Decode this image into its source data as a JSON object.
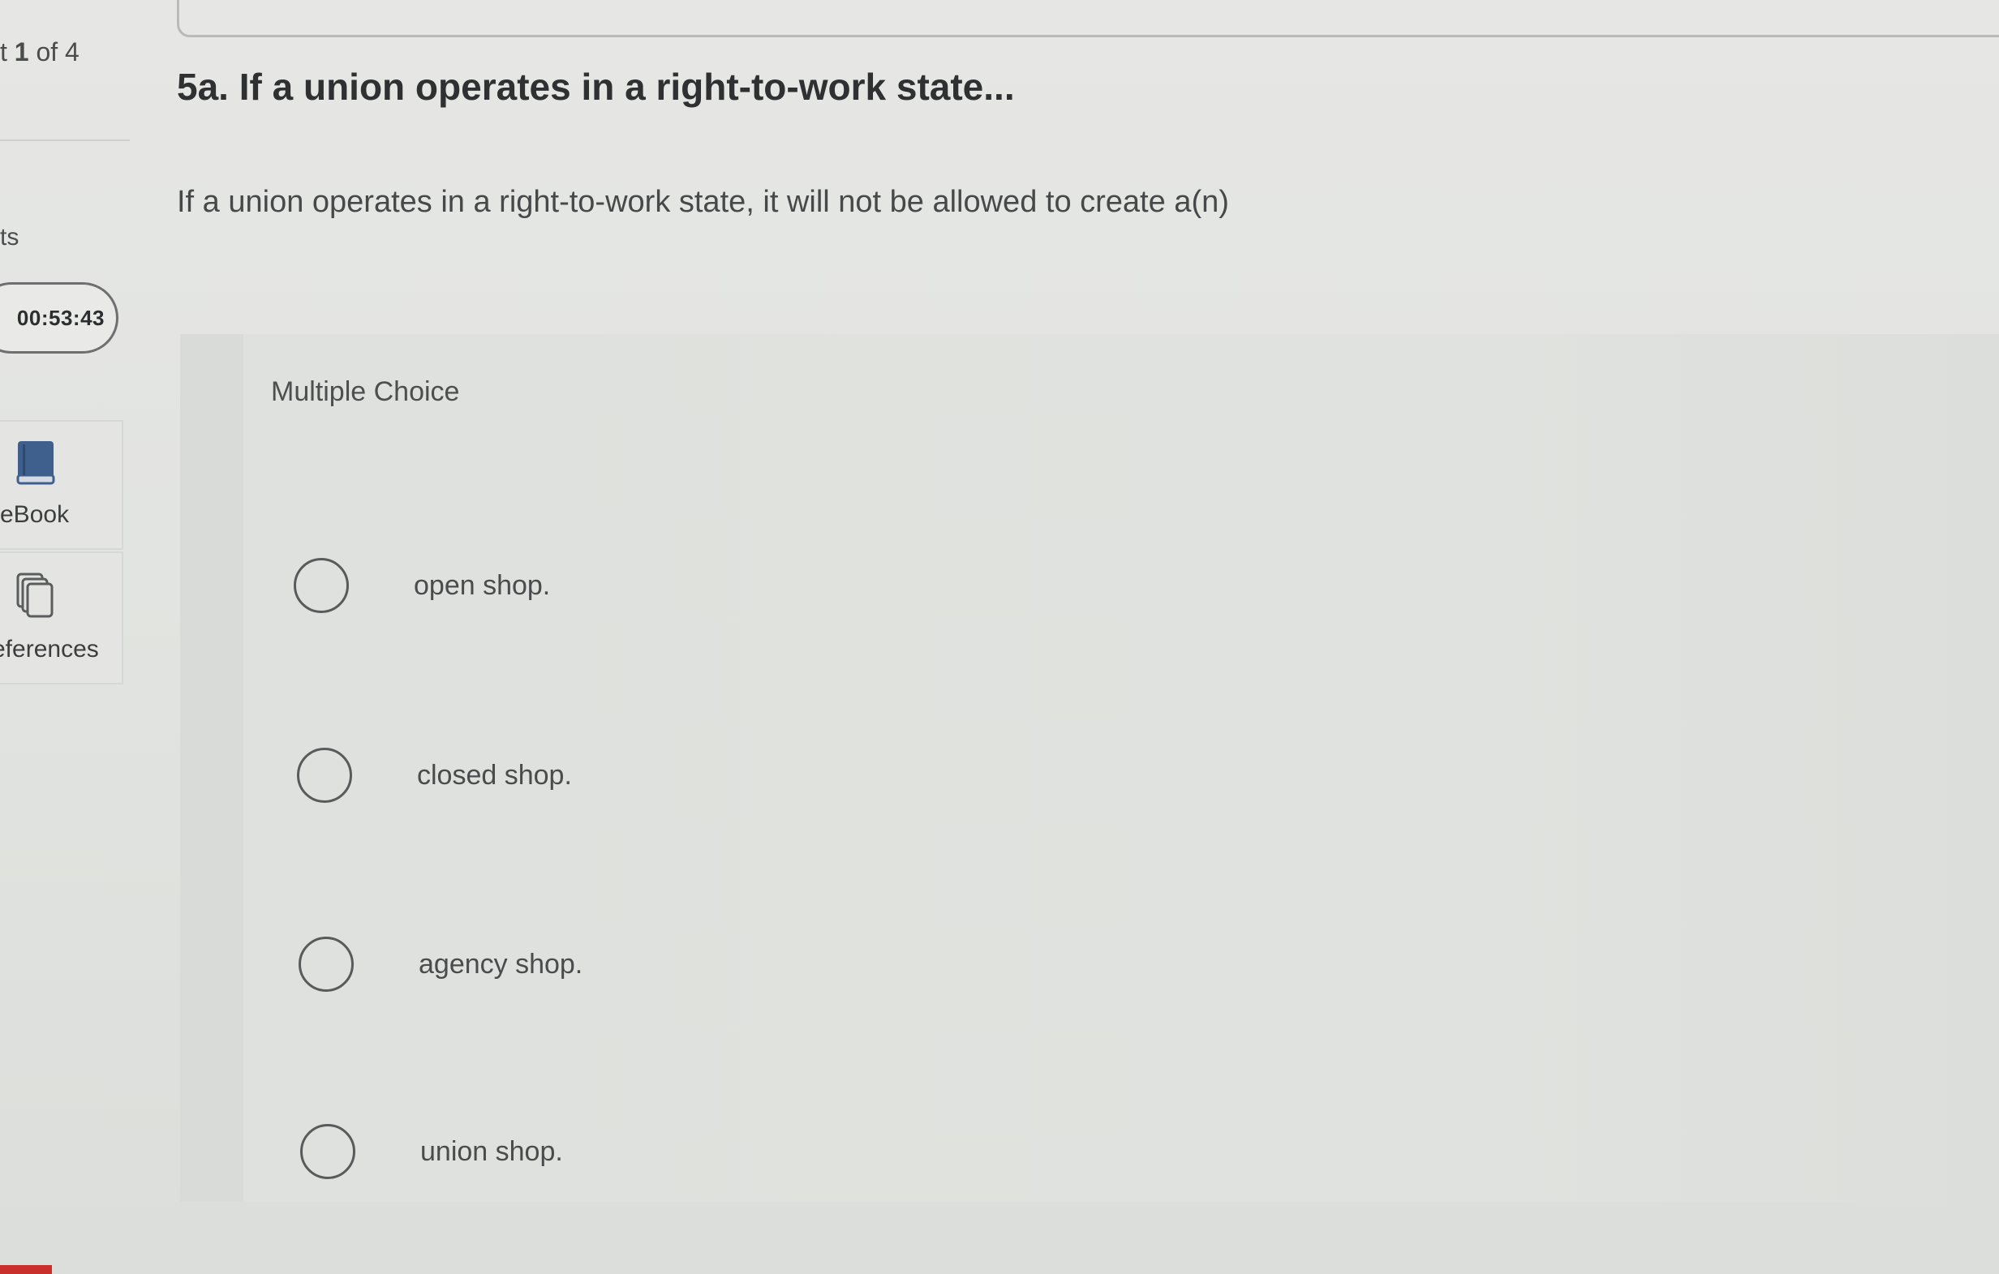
{
  "sidebar": {
    "progress_prefix": "t ",
    "progress_current": "1",
    "progress_suffix": " of 4",
    "points_label": "ts",
    "timer": "00:53:43",
    "tools": [
      {
        "label": "eBook",
        "icon": "book-icon"
      },
      {
        "label": "eferences",
        "icon": "references-icon"
      }
    ]
  },
  "question": {
    "title": "5a. If a union operates in a right-to-work state...",
    "prompt": "If a union operates in a right-to-work state, it will not be allowed to create a(n)"
  },
  "multiple_choice": {
    "label": "Multiple Choice",
    "options": [
      {
        "text": "open shop."
      },
      {
        "text": "closed shop."
      },
      {
        "text": "agency shop."
      },
      {
        "text": "union shop."
      }
    ]
  },
  "colors": {
    "background": "#e3e4e2",
    "text": "#3a3b3c",
    "accent_red": "#c8302b"
  }
}
